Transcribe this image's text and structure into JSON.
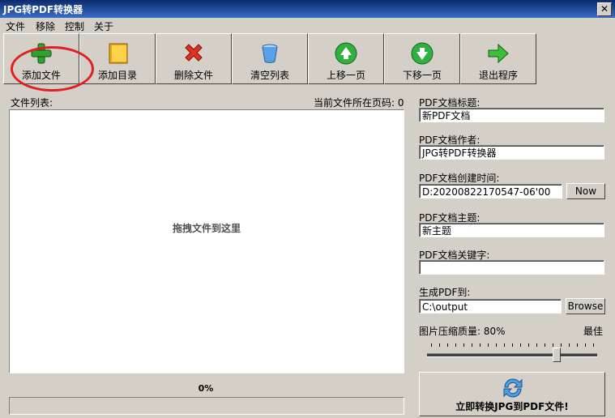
{
  "window": {
    "title": "JPG转PDF转换器",
    "close_label": "✕"
  },
  "menu": [
    "文件",
    "移除",
    "控制",
    "关于"
  ],
  "toolbar": [
    {
      "label": "添加文件",
      "icon": "add-file-icon"
    },
    {
      "label": "添加目录",
      "icon": "add-folder-icon"
    },
    {
      "label": "删除文件",
      "icon": "delete-icon"
    },
    {
      "label": "清空列表",
      "icon": "clear-list-icon"
    },
    {
      "label": "上移一页",
      "icon": "move-up-icon"
    },
    {
      "label": "下移一页",
      "icon": "move-down-icon"
    },
    {
      "label": "退出程序",
      "icon": "exit-icon"
    }
  ],
  "left": {
    "file_list_label": "文件列表:",
    "page_indicator": "当前文件所在页码: 0",
    "drop_hint": "拖拽文件到这里",
    "progress_text": "0%",
    "progress_value": 0
  },
  "right": {
    "title_label": "PDF文档标题:",
    "title_value": "新PDF文档",
    "author_label": "PDF文档作者:",
    "author_value": "JPG转PDF转换器",
    "created_label": "PDF文档创建时间:",
    "created_value": "D:20200822170547-06'00",
    "now_button": "Now",
    "subject_label": "PDF文档主题:",
    "subject_value": "新主题",
    "keywords_label": "PDF文档关键字:",
    "keywords_value": "",
    "output_label": "生成PDF到:",
    "output_value": "C:\\output",
    "browse_button": "Browse",
    "quality_label": "图片压缩质量: 80%",
    "quality_best": "最佳",
    "quality_value": 80,
    "convert_button": "立即转换JPG到PDF文件!"
  },
  "colors": {
    "annotation": "#e02020",
    "titlebar": "#0a2c6b"
  }
}
